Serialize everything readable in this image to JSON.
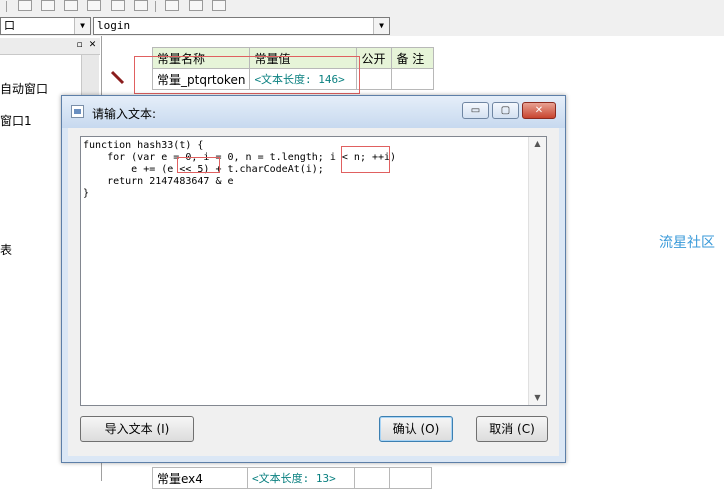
{
  "combo": {
    "left_value": "口",
    "right_value": "login"
  },
  "left_panel": {
    "items": [
      "自动窗口",
      "窗口1",
      "表"
    ]
  },
  "constants_table": {
    "headers": [
      "常量名称",
      "常量值",
      "公开",
      "备 注"
    ],
    "rows": [
      {
        "name": "常量_ptqrtoken",
        "value": "<文本长度: 146>"
      },
      {
        "name": "常量ex4",
        "value": "<文本长度: 13>"
      }
    ]
  },
  "watermark": "流星社区",
  "dialog": {
    "title": "请输入文本:",
    "code": "function hash33(t) {\n    for (var e = 0, i = 0, n = t.length; i < n; ++i)\n        e += (e << 5) + t.charCodeAt(i);\n    return 2147483647 & e\n}",
    "buttons": {
      "import": "导入文本 (I)",
      "ok": "确认 (O)",
      "cancel": "取消 (C)"
    },
    "window_buttons": {
      "minimize": "▭",
      "maximize": "▢",
      "close": "✕"
    }
  },
  "colors": {
    "header_bg": "#e6f4d8",
    "value_text": "#0a8080",
    "highlight_box": "#e06060",
    "watermark": "#3a9ad9"
  }
}
